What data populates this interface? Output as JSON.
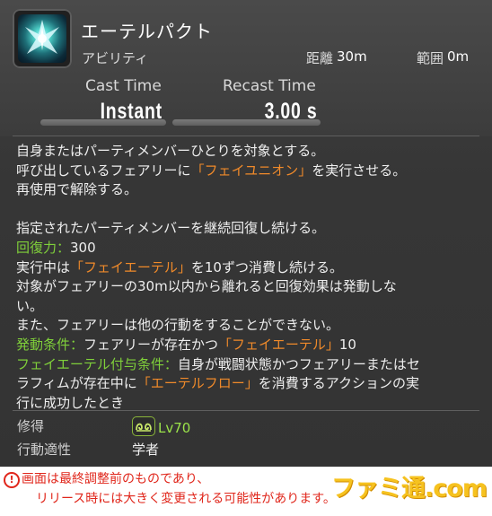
{
  "header": {
    "action_name": "エーテルパクト",
    "category": "アビリティ",
    "range_label": "距離",
    "range_value": "30m",
    "radius_label": "範囲",
    "radius_value": "0m",
    "icon": "fairy-pact-icon"
  },
  "timing": {
    "cast_label": "Cast Time",
    "cast_value": "Instant",
    "recast_label": "Recast Time",
    "recast_value": "3.00 s"
  },
  "description": {
    "line1": "自身またはパーティメンバーひとりを対象とする。",
    "line2_pre": "呼び出しているフェアリーに",
    "line2_skill": "「フェイユニオン」",
    "line2_post": "を実行させる。",
    "line3": "再使用で解除する。",
    "line4": "指定されたパーティメンバーを継続回復し続ける。",
    "potency_label": "回復力：",
    "potency_value": "300",
    "line6_pre": "実行中は",
    "line6_skill": "「フェイエーテル」",
    "line6_post": "を10ずつ消費し続ける。",
    "line7": "対象がフェアリーの30m以内から離れると回復効果は発動しな",
    "line8": "い。",
    "line9": "また、フェアリーは他の行動をすることができない。",
    "cond_label": "発動条件：",
    "cond_pre": "フェアリーが存在かつ",
    "cond_skill": "「フェイエーテル」",
    "cond_post": "10",
    "grant_label": "フェイエーテル付与条件：",
    "grant_text": "自身が戦闘状態かつフェアリーまたはセ",
    "grant_line2_pre": "ラフィムが存在中に",
    "grant_line2_skill": "「エーテルフロー」",
    "grant_line2_post": "を消費するアクションの実",
    "grant_line3": "行に成功したとき"
  },
  "meta": {
    "acquired_label": "修得",
    "level": "Lv70",
    "job_icon": "scholar-job-icon",
    "usable_label": "行動適性",
    "usable_value": "学者"
  },
  "notice": {
    "mark": "!",
    "line1": "画面は最終調整前のものであり、",
    "line2": "リリース時には大きく変更される可能性があります。"
  },
  "watermark": "ファミ通.com",
  "colors": {
    "skill_orange": "#f08a2a",
    "label_green": "#7fcf3a",
    "notice_red": "#e0261b",
    "watermark_yellow": "#f6c21f"
  }
}
